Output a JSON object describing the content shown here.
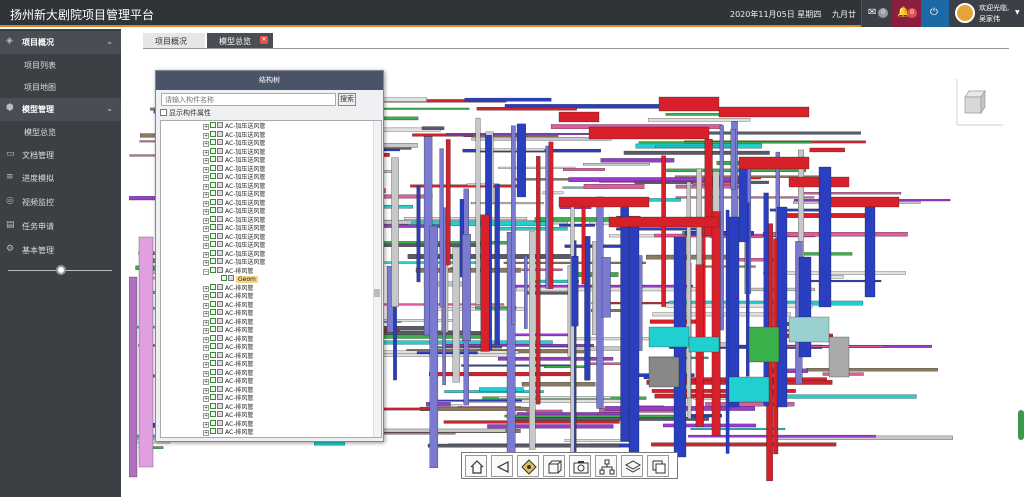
{
  "header": {
    "title": "扬州新大剧院项目管理平台",
    "datetime": "2020年11月05日 星期四",
    "lunar": "九月廿",
    "msg_count": "0",
    "notice_count": "0",
    "welcome": "欢迎光临,",
    "user_name": "吴家伟"
  },
  "sidebar": {
    "items": [
      {
        "label": "项目概况",
        "icon": "layers-icon",
        "section": true
      },
      {
        "label": "项目列表"
      },
      {
        "label": "项目地图"
      },
      {
        "label": "模型管理",
        "icon": "cube-icon",
        "section": true
      },
      {
        "label": "模型总览"
      },
      {
        "label": "文档管理",
        "icon": "folder-icon"
      },
      {
        "label": "进度模拟",
        "icon": "sliders-icon"
      },
      {
        "label": "视频监控",
        "icon": "camera-icon"
      },
      {
        "label": "任务申请",
        "icon": "clipboard-icon"
      },
      {
        "label": "基本管理",
        "icon": "gear-icon"
      }
    ]
  },
  "tabs": [
    {
      "label": "项目概况"
    },
    {
      "label": "模型总览",
      "active": true
    }
  ],
  "tree": {
    "title": "结构树",
    "search_placeholder": "请输入构件名称",
    "search_button": "搜索",
    "show_props_label": "显示构件属性",
    "rows": [
      "AC-加压送风管",
      "AC-加压送风管",
      "AC-加压送风管",
      "AC-加压送风管",
      "AC-加压送风管",
      "AC-加压送风管",
      "AC-加压送风管",
      "AC-加压送风管",
      "AC-加压送风管",
      "AC-加压送风管",
      "AC-加压送风管",
      "AC-加压送风管",
      "AC-加压送风管",
      "AC-加压送风管",
      "AC-加压送风管",
      "AC-加压送风管",
      "AC-加压送风管",
      "AC-排风管",
      "Geom",
      "AC-排风管",
      "AC-排风管",
      "AC-排风管",
      "AC-排风管",
      "AC-排风管",
      "AC-排风管",
      "AC-排风管",
      "AC-排风管",
      "AC-排风管",
      "AC-排风管",
      "AC-排风管",
      "AC-排风管",
      "AC-排风管",
      "AC-排风管",
      "AC-排风管",
      "AC-排风管",
      "AC-排风管",
      "AC-排风管"
    ]
  },
  "toolbar": {
    "tools": [
      "home-icon",
      "back-icon",
      "explode-icon",
      "cube-view-icon",
      "camera-icon",
      "tree-icon",
      "layers-icon",
      "copy-icon"
    ]
  },
  "colors": {
    "topbar": "#2f3439",
    "accent": "#d9862c",
    "sidebar": "#3c3f44",
    "pipe_red": "#d8202a",
    "pipe_blue": "#2a3fc0",
    "pipe_cyan": "#20d0d0",
    "pipe_purple": "#9a3ad0"
  }
}
